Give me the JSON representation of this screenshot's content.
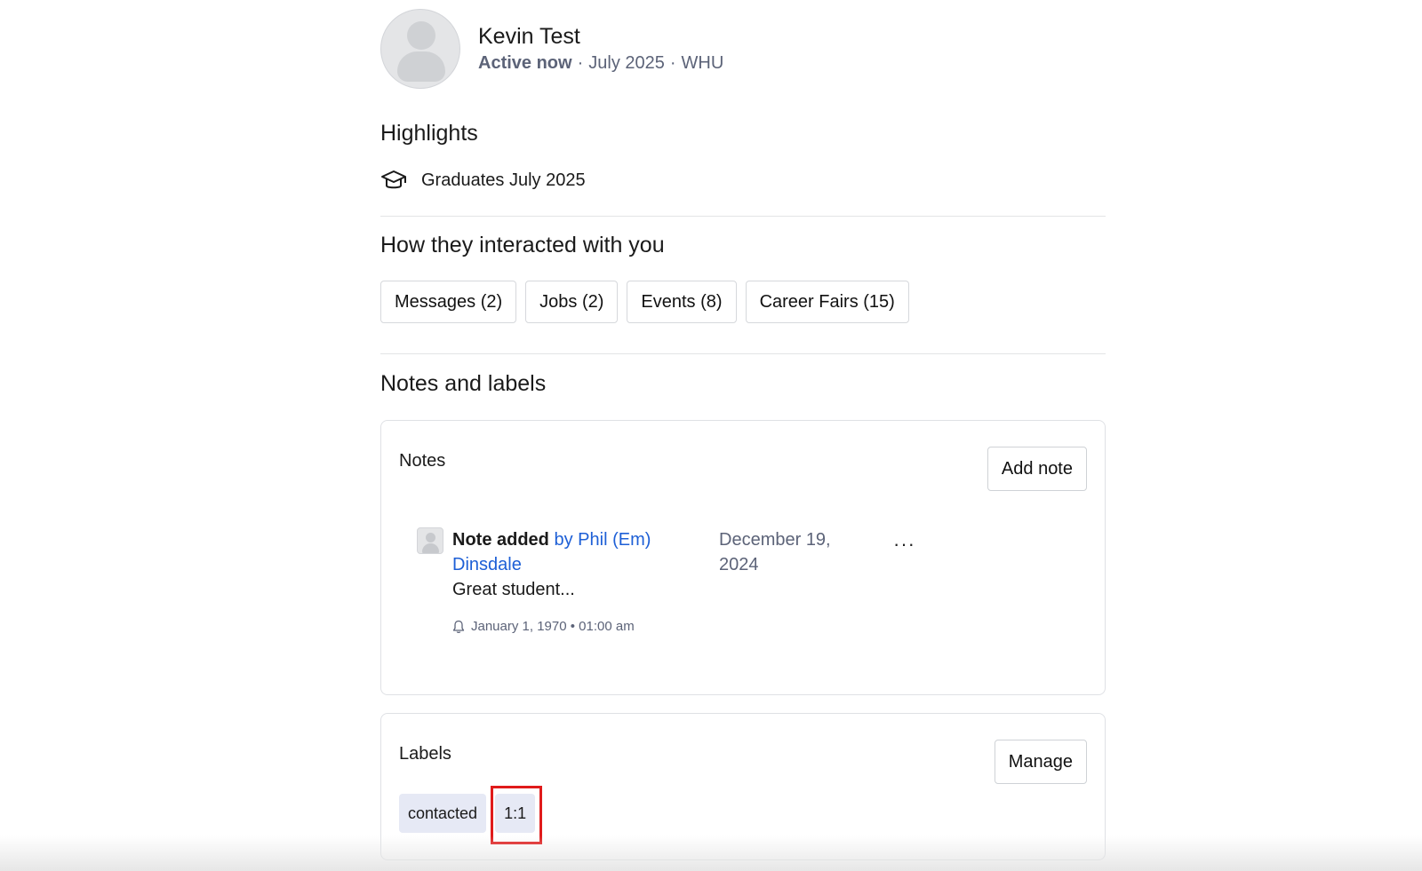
{
  "profile": {
    "name": "Kevin Test",
    "status": "Active now",
    "separator": "·",
    "graduation": "July 2025",
    "school": "WHU"
  },
  "highlights": {
    "title": "Highlights",
    "items": [
      {
        "icon": "graduation-cap-icon",
        "text": "Graduates July 2025"
      }
    ]
  },
  "interactions": {
    "title": "How they interacted with you",
    "chips": [
      {
        "label": "Messages (2)"
      },
      {
        "label": "Jobs (2)"
      },
      {
        "label": "Events (8)"
      },
      {
        "label": "Career Fairs (15)"
      }
    ]
  },
  "notes_and_labels": {
    "title": "Notes and labels",
    "notes": {
      "title": "Notes",
      "add_label": "Add note",
      "items": [
        {
          "action": "Note added",
          "by": "by",
          "author": "Phil (Em) Dinsdale",
          "date": "December 19, 2024",
          "more": "···",
          "body": "Great student...",
          "reminder": "January 1, 1970 • 01:00 am",
          "reminder_icon": "bell-icon"
        }
      ]
    },
    "labels": {
      "title": "Labels",
      "manage_label": "Manage",
      "tags": [
        {
          "label": "contacted"
        },
        {
          "label": "1:1"
        }
      ]
    }
  },
  "colors": {
    "link": "#1d5fd6",
    "muted": "#5c6378",
    "tag_bg": "#e6e9f5",
    "highlight": "#e01b1b"
  }
}
